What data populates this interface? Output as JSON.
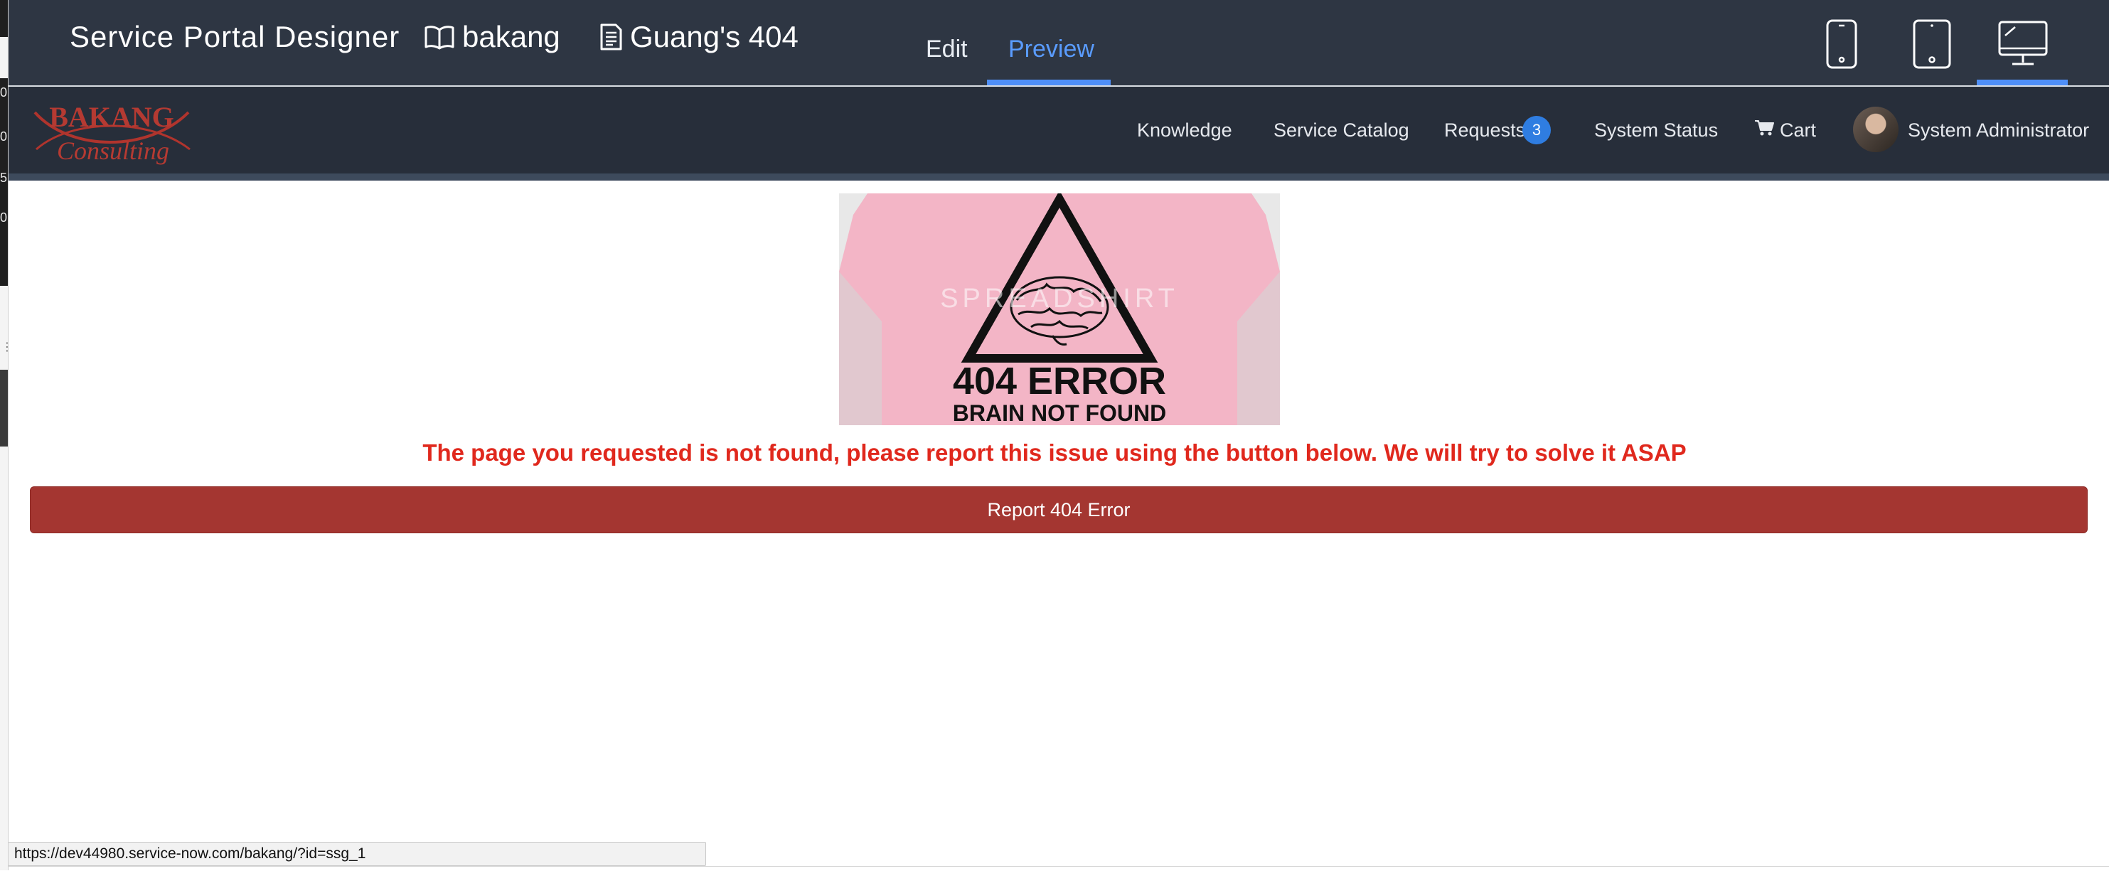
{
  "designer": {
    "title": "Service Portal Designer",
    "portal_name": "bakang",
    "page_name": "Guang's 404",
    "tabs": [
      {
        "label": "Edit",
        "active": false
      },
      {
        "label": "Preview",
        "active": true
      }
    ],
    "devices": [
      {
        "name": "phone-icon",
        "active": false
      },
      {
        "name": "tablet-icon",
        "active": false
      },
      {
        "name": "desktop-icon",
        "active": true
      }
    ],
    "accent_color": "#4f8ff7"
  },
  "portal": {
    "logo_text": {
      "line1": "BAKANG",
      "line2": "Consulting"
    },
    "nav": {
      "knowledge": "Knowledge",
      "service_catalog": "Service Catalog",
      "requests": "Requests",
      "requests_count": "3",
      "system_status": "System Status",
      "cart": "Cart",
      "user_name": "System Administrator"
    },
    "header_color": "#272e3a"
  },
  "content": {
    "image": {
      "watermark": "SPREADSHIRT",
      "headline": "404 ERROR",
      "subline": "BRAIN NOT FOUND"
    },
    "message": "The page you requested is not found, please report this issue using the button below. We will try to solve it ASAP",
    "button_label": "Report 404 Error",
    "message_color": "#e0281d",
    "button_color": "#a43631"
  },
  "status_bar": {
    "url": "https://dev44980.service-now.com/bakang/?id=ssg_1"
  },
  "gutter": {
    "digits": [
      "0",
      "0",
      "5",
      "0"
    ]
  }
}
